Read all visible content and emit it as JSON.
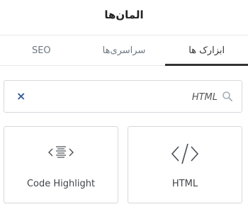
{
  "header": {
    "title": "المان‌ها"
  },
  "tabs": [
    {
      "label": "ابزارک ها",
      "active": true
    },
    {
      "label": "سراسری‌ها",
      "active": false
    },
    {
      "label": "SEO",
      "active": false
    }
  ],
  "search": {
    "value": "HTML",
    "clear_icon": "close-icon",
    "search_icon": "search-icon"
  },
  "widgets": [
    {
      "label": "HTML",
      "icon": "code-icon"
    },
    {
      "label": "Code Highlight",
      "icon": "code-highlight-icon"
    }
  ],
  "colors": {
    "accent_tab": "#333333",
    "clear_icon": "#3a5a9a",
    "border": "#d5d8dc"
  }
}
